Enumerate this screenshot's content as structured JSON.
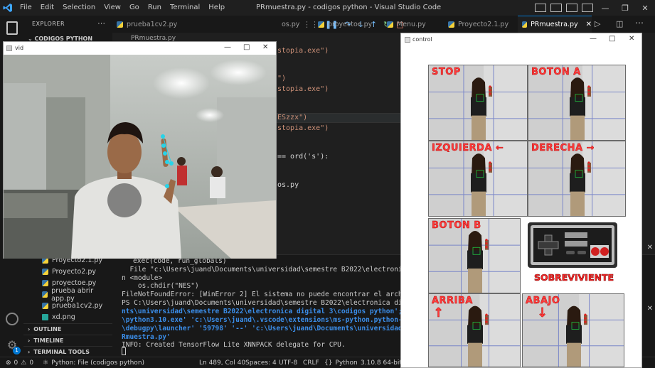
{
  "titlebar": {
    "menu": [
      "File",
      "Edit",
      "Selection",
      "View",
      "Go",
      "Run",
      "Terminal",
      "Help"
    ],
    "title": "PRmuestra.py - codigos python - Visual Studio Code"
  },
  "sidebar": {
    "header": "EXPLORER",
    "folder": "CODIGOS PYTHON",
    "files": [
      "Proyecto2.1.py",
      "Proyecto2.py",
      "proyectoe.py",
      "prueba abrir app.py",
      "prueba1cv2.py",
      "xd.png"
    ],
    "sections": [
      "OUTLINE",
      "TIMELINE",
      "TERMINAL TOOLS"
    ]
  },
  "tabs": [
    {
      "label": "prueba1cv2.py",
      "active": false
    },
    {
      "label": "os.py",
      "active": false
    },
    {
      "label": "proyectoe.py",
      "active": false
    },
    {
      "label": "Menu.py",
      "active": false
    },
    {
      "label": "Proyecto2.1.py",
      "active": false
    },
    {
      "label": "PRmuestra.py",
      "active": true
    }
  ],
  "breadcrumb": "PRmuestra.py",
  "editor": {
    "lines": [
      "stopia.exe\")",
      "\")",
      "stopia.exe\")",
      "ESzzx\")",
      "stopia.exe\")",
      "== ord('s'):",
      "os.py"
    ]
  },
  "terminal": {
    "lines": [
      "exec(code, run_globals)",
      "  File \"c:\\Users\\juand\\Documents\\universidad\\semestre B2022\\electronica dig",
      "n <module>",
      "    os.chdir(\"NES\")",
      "FileNotFoundError: [WinError 2] El sistema no puede encontrar el archivo e",
      "PS C:\\Users\\juand\\Documents\\universidad\\semestre B2022\\electronica digital",
      "nts\\universidad\\semestre B2022\\electronica digital 3\\codigos python'; & 'C",
      "\\python3.10.exe' 'c:\\Users\\juand\\.vscode\\extensions\\ms-python.python-2022.",
      "\\debugpy\\launcher' '59798' '--' 'c:\\Users\\juand\\Documents\\universidad\\seme",
      "Rmuestra.py'",
      "INFO: Created TensorFlow Lite XNNPACK delegate for CPU."
    ]
  },
  "statusbar": {
    "errors": "0",
    "warnings": "0",
    "interpreter": "Python: File (codigos python)",
    "position": "Ln 489, Col 40",
    "spaces": "Spaces: 4",
    "encoding": "UTF-8",
    "eol": "CRLF",
    "language": "Python",
    "version": "3.10.8 64-bit (r"
  },
  "vid_window": {
    "title": "vid"
  },
  "control_window": {
    "title": "control",
    "cells": [
      "STOP",
      "BOTON A",
      "IZQUIERDA ←",
      "DERECHA →",
      "BOTON B",
      "ARRIBA",
      "ABAJO"
    ],
    "arrows": {
      "up": "↑",
      "down": "↓"
    },
    "nes_label": "SOBREVIVIENTE"
  },
  "colors": {
    "accent": "#0078d4",
    "label_red": "#ff3a3a"
  }
}
